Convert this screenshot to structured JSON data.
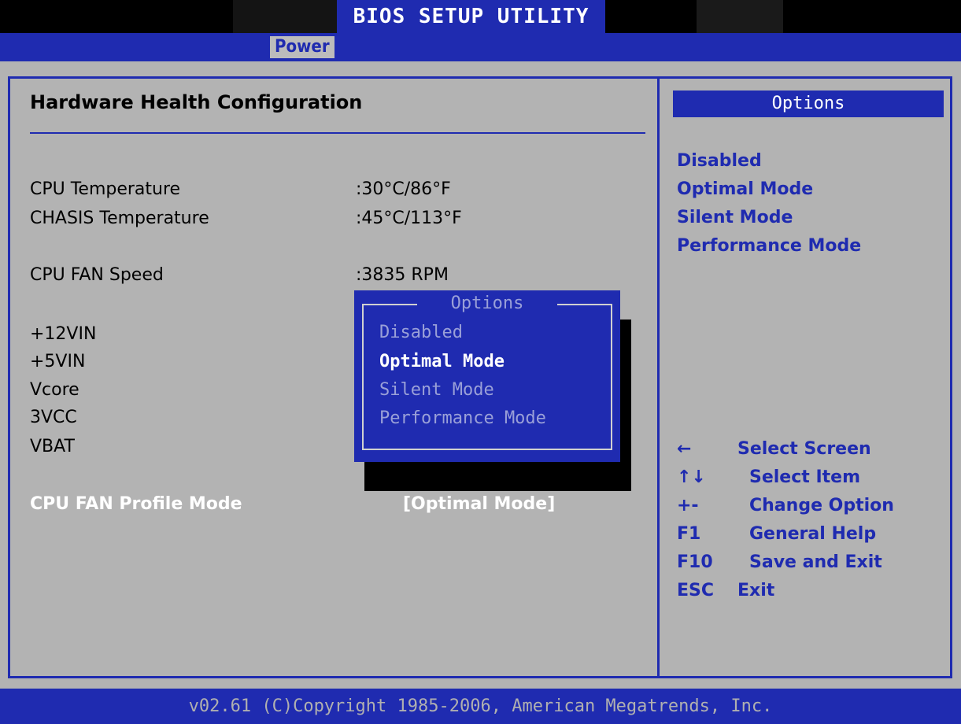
{
  "title": "BIOS SETUP UTILITY",
  "tab": "Power",
  "section_title": "Hardware Health Configuration",
  "readings": [
    {
      "label": "CPU Temperature",
      "value": ":30°C/86°F"
    },
    {
      "label": "CHASIS Temperature",
      "value": ":45°C/113°F"
    },
    {
      "label": "CPU FAN Speed",
      "value": ":3835 RPM"
    },
    {
      "label": "+12VIN",
      "value": ""
    },
    {
      "label": "+5VIN",
      "value": ""
    },
    {
      "label": "Vcore",
      "value": ""
    },
    {
      "label": "3VCC",
      "value": ""
    },
    {
      "label": "VBAT",
      "value": ""
    }
  ],
  "setting": {
    "label": "CPU FAN Profile Mode",
    "value": "[Optimal Mode]"
  },
  "help_panel": {
    "header": "Options",
    "options": [
      "Disabled",
      "Optimal Mode",
      "Silent Mode",
      "Performance Mode"
    ]
  },
  "popup": {
    "title": "Options",
    "items": [
      "Disabled",
      "Optimal Mode",
      "Silent Mode",
      "Performance Mode"
    ],
    "selected": "Optimal Mode"
  },
  "keys": [
    {
      "key": "←",
      "desc": "Select Screen"
    },
    {
      "key": "↑↓",
      "desc": "Select Item"
    },
    {
      "key": "+-",
      "desc": "Change Option"
    },
    {
      "key": "F1",
      "desc": "General Help"
    },
    {
      "key": "F10",
      "desc": "Save and Exit"
    },
    {
      "key": "ESC",
      "desc": "Exit"
    }
  ],
  "footer": "v02.61 (C)Copyright 1985-2006, American Megatrends, Inc.",
  "colors": {
    "bios_blue": "#1f2bb0",
    "panel_gray": "#b3b3b3"
  }
}
